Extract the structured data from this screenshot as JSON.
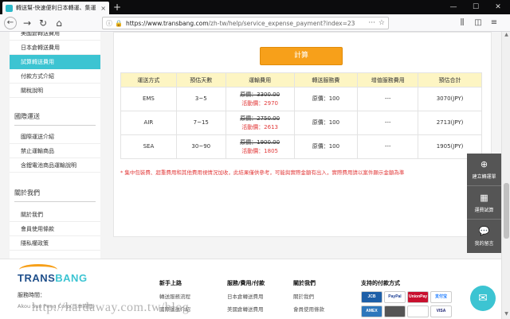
{
  "browser": {
    "tab_title": "轉送幫-快速便利日本轉運、集運",
    "tab_close": "×",
    "new_tab": "+",
    "url_host": "https://www.transbang.com",
    "url_path": "/zh-tw/help/service_expense_payment?index=23",
    "win_min": "—",
    "win_max": "☐",
    "win_close": "✕"
  },
  "sidebar": {
    "items_top": [
      {
        "label": "美國倉轉送費用"
      },
      {
        "label": "日本倉轉送費用"
      },
      {
        "label": "試算轉送費用",
        "active": true
      },
      {
        "label": "付款方式介紹"
      },
      {
        "label": "關稅說明"
      }
    ],
    "section_shipping": "國際運送",
    "items_shipping": [
      {
        "label": "國際運送介紹"
      },
      {
        "label": "禁止運輸商品"
      },
      {
        "label": "含鋰電池商品運輸說明"
      }
    ],
    "section_about": "關於我們",
    "items_about": [
      {
        "label": "關於我們"
      },
      {
        "label": "會員使用條款"
      },
      {
        "label": "隱私權政策"
      }
    ]
  },
  "main": {
    "calc_button": "計算",
    "table": {
      "headers": [
        "運送方式",
        "預估天數",
        "運輸費用",
        "轉送服務費",
        "增值服務費用",
        "預估合計"
      ],
      "rows": [
        {
          "method": "EMS",
          "days": "3~5",
          "orig": "原價：3300.00",
          "promo": "活動價：2970",
          "service": "原價：100",
          "extra": "---",
          "total": "3070(JPY)"
        },
        {
          "method": "AIR",
          "days": "7~15",
          "orig": "原價：2750.00",
          "promo": "活動價：2613",
          "service": "原價：100",
          "extra": "---",
          "total": "2713(JPY)"
        },
        {
          "method": "SEA",
          "days": "30~90",
          "orig": "原價：1900.00",
          "promo": "活動價：1805",
          "service": "原價：100",
          "extra": "---",
          "total": "1905(JPY)"
        }
      ]
    },
    "note": "* 集中包裝費、超重費用和其他費用視情況加收，此結果僅供參考，可能與實際金額有出入，實際費用請以案件顯示金額為準"
  },
  "floating": {
    "create_order": "建立轉運單",
    "estimate": "運費試算",
    "messages": "我的留言"
  },
  "footer": {
    "logo_trans": "TRANS",
    "logo_bang": "BANG",
    "service_time": "服務時間：",
    "service_sub": "Akou Sun Peng Corp(日本時間)",
    "col1_title": "新手上路",
    "col1_links": [
      "轉送服務流程",
      "國際運送介紹"
    ],
    "col2_title": "服務/費用/付款",
    "col2_links": [
      "日本倉轉送費用",
      "美國倉轉送費用"
    ],
    "col3_title": "關於我們",
    "col3_links": [
      "關於我們",
      "會員使用條款"
    ],
    "pay_title": "支持的付款方式",
    "payments": [
      "JCB",
      "PayPal",
      "UnionPay",
      "支付宝",
      "AMEX",
      "",
      "",
      "VISA"
    ]
  },
  "watermark": "http://hardaway.com.tw/blog"
}
